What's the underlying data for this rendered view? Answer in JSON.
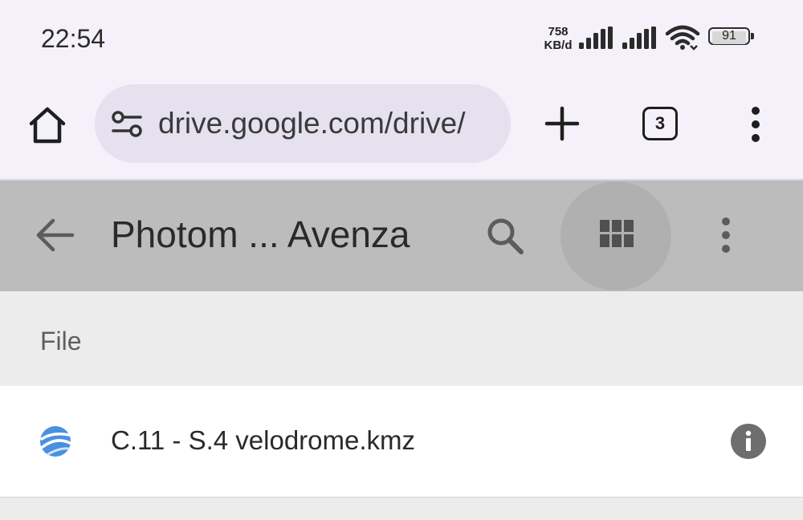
{
  "status_bar": {
    "time": "22:54",
    "net_speed_value": "758",
    "net_speed_unit": "KB/d",
    "battery_level": "91",
    "icons": [
      "signal-icon",
      "signal-icon",
      "wifi-icon",
      "battery-icon"
    ]
  },
  "browser": {
    "url": "drive.google.com/drive/",
    "tab_count": "3",
    "icons": [
      "home-icon",
      "site-settings-icon",
      "plus-icon",
      "tabs-icon",
      "more-vert-icon"
    ]
  },
  "drive_bar": {
    "title": "Photom ... Avenza",
    "icons": [
      "back-arrow-icon",
      "search-icon",
      "grid-view-icon",
      "more-vert-icon"
    ]
  },
  "section": {
    "title": "File"
  },
  "files": [
    {
      "name": "C.11 - S.4 velodrome.kmz",
      "icon": "google-earth-icon",
      "action_icon": "info-icon"
    }
  ],
  "colors": {
    "browser_bg": "#f5f1fa",
    "url_pill_bg": "#e5e1ef",
    "app_bar_bg": "#bcbcbc",
    "section_bg": "#ececec",
    "earth_blue": "#4a8fe0",
    "info_grey": "#6e6e6e"
  }
}
